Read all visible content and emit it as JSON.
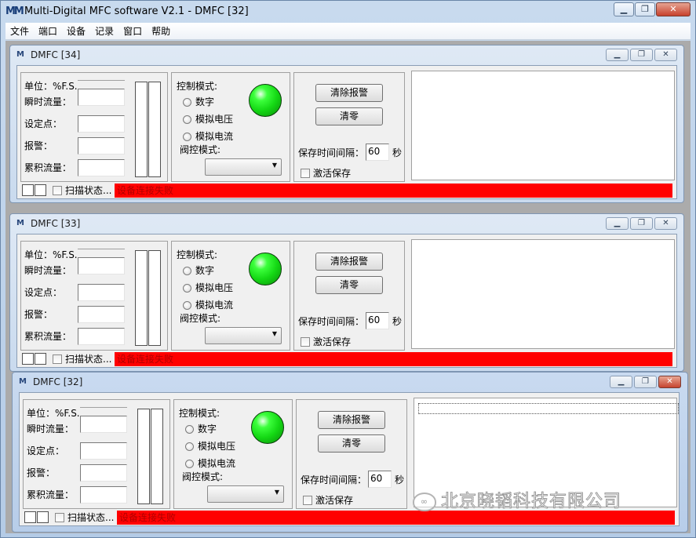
{
  "app": {
    "title": "Multi-Digital MFC software V2.1 - DMFC [32]",
    "icon": "app-logo-icon",
    "window_buttons": [
      "minimize",
      "restore",
      "close"
    ]
  },
  "menu": [
    "文件",
    "端口",
    "设备",
    "记录",
    "窗口",
    "帮助"
  ],
  "labels": {
    "unit": "单位：%F.S.",
    "flow": "瞬时流量：",
    "setpoint": "设定点：",
    "alarm": "报警：",
    "total": "累积流量：",
    "control_mode": "控制模式:",
    "digital": "数字",
    "analog_voltage": "模拟电压",
    "analog_current": "模拟电流",
    "valve_mode": "阀控模式:",
    "clear_alarm": "清除报警",
    "zero": "清零",
    "save_interval": "保存时间间隔：",
    "seconds": "秒",
    "activate_save": "激活保存",
    "scan_status": "扫描状态..."
  },
  "windows": [
    {
      "title": "DMFC [34]",
      "save_interval": "60",
      "status": "设备连接失败",
      "active": false
    },
    {
      "title": "DMFC [33]",
      "save_interval": "60",
      "status": "设备连接失败",
      "active": false
    },
    {
      "title": "DMFC [32]",
      "save_interval": "60",
      "status": "设备连接失败",
      "active": true
    }
  ],
  "colors": {
    "led": "#22dd22",
    "status_bar": "#ff0000",
    "status_text": "#b00000"
  },
  "watermark": "北京晓韬科技有限公司"
}
